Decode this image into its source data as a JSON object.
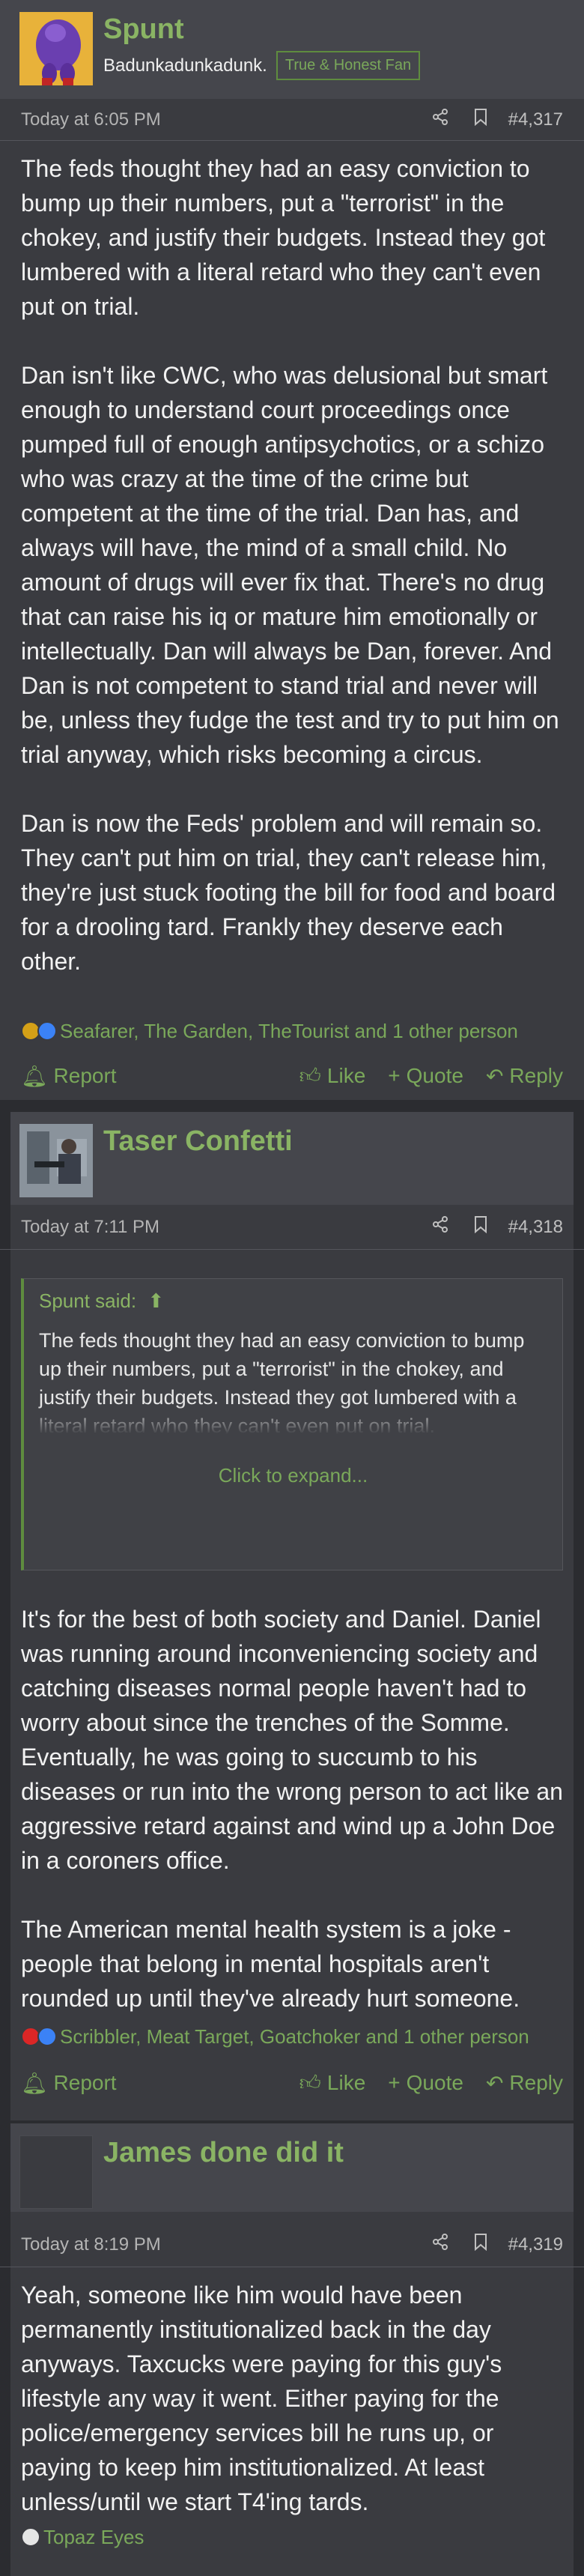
{
  "posts": [
    {
      "username": "Spunt",
      "user_title": "Badunkadunkadunk.",
      "banner": "True & Honest Fan",
      "avatar_icon": "purple-character-avatar",
      "timestamp": "Today at 6:05 PM",
      "post_number": "#4,317",
      "paragraphs": [
        "The feds thought they had an easy conviction to bump up their numbers, put a \"terrorist\" in the chokey, and justify their budgets. Instead they got lumbered with a literal retard who they can't even put on trial.",
        "Dan isn't like CWC, who was delusional but smart enough to understand court proceedings once pumped full of enough antipsychotics, or a schizo who was crazy at the time of the crime but competent at the time of the trial. Dan has, and always will have, the mind of a small child. No amount of drugs will ever fix that. There's no drug that can raise his iq or mature him emotionally or intellectually. Dan will always be Dan, forever. And Dan is not competent to stand trial and never will be, unless they fudge the test and try to put him on trial anyway, which risks becoming a circus.",
        "Dan is now the Feds' problem and will remain so. They can't put him on trial, they can't release him, they're just stuck footing the bill for food and board for a drooling tard. Frankly they deserve each other."
      ],
      "reactions_text": "Seafarer, The Garden, TheTourist and 1 other person",
      "reaction_colors": [
        "#d4a017",
        "#3b82f6"
      ]
    },
    {
      "username": "Taser Confetti",
      "avatar_icon": "photo-avatar",
      "timestamp": "Today at 7:11 PM",
      "post_number": "#4,318",
      "quote": {
        "author": "Spunt said:",
        "text": "The feds thought they had an easy conviction to bump up their numbers, put a \"terrorist\" in the chokey, and justify their budgets. Instead they got lumbered with a literal retard who they can't even put on trial.",
        "expand_label": "Click to expand..."
      },
      "paragraphs": [
        "It's for the best of both society and Daniel. Daniel was running around inconveniencing society and catching diseases normal people haven't had to worry about since the trenches of the Somme. Eventually, he was going to succumb to his diseases or run into the wrong person to act like an aggressive retard against and wind up a John Doe in a coroners office.",
        "The American mental health system is a joke - people that belong in mental hospitals aren't rounded up until they've already hurt someone."
      ],
      "reactions_text": "Scribbler, Meat Target, Goatchoker and 1 other person",
      "reaction_colors": [
        "#dc2626",
        "#3b82f6"
      ]
    },
    {
      "username": "James done did it",
      "avatar_icon": "blank-avatar",
      "timestamp": "Today at 8:19 PM",
      "post_number": "#4,319",
      "paragraphs": [
        "Yeah, someone like him would have been permanently institutionalized back in the day anyways. Taxcucks were paying for this guy's lifestyle any way it went. Either paying for the police/emergency services bill he runs up, or paying to keep him institutionalized. At least unless/until we start T4'ing tards."
      ],
      "reactions_text": "Topaz Eyes",
      "reaction_colors": [
        "#e5e5e5"
      ]
    }
  ],
  "actions": {
    "report": "Report",
    "like": "Like",
    "quote": "Quote",
    "reply": "Reply"
  }
}
